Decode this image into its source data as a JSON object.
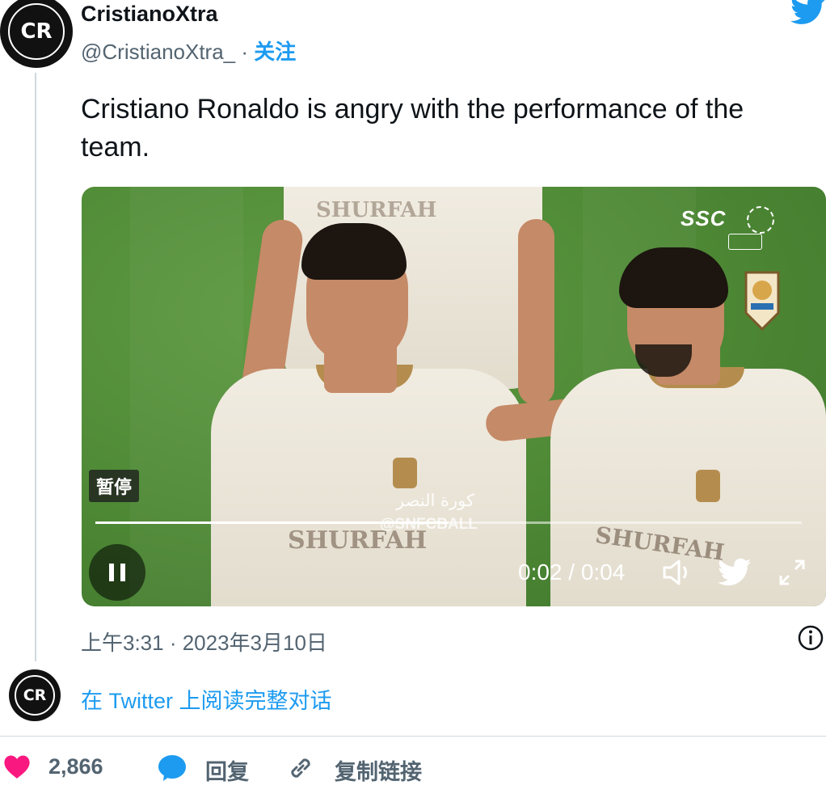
{
  "author": {
    "display_name": "CristianoXtra",
    "handle": "@CristianoXtra_",
    "separator": "·",
    "follow_label": "关注",
    "avatar_text": "CR"
  },
  "tweet": {
    "text": "Cristiano Ronaldo is angry with the performance of the team.",
    "timestamp": "上午3:31 · 2023年3月10日"
  },
  "video": {
    "overlay_label": "暂停",
    "time_display": "0:02 / 0:04",
    "progress_fraction": 0.5,
    "broadcaster": "SSC",
    "watermark_arabic": "كورة النصر",
    "watermark_handle": "@SNFCBALL",
    "jersey_sponsor": "SHURFAH"
  },
  "footer": {
    "read_conversation": "在 Twitter 上阅读完整对话",
    "likes_count": "2,866",
    "reply_label": "回复",
    "copy_link_label": "复制链接"
  },
  "colors": {
    "accent": "#1d9bf0",
    "like": "#f91880",
    "secondary_text": "#536471"
  },
  "icons": [
    "twitter-bird-icon",
    "info-icon",
    "heart-icon",
    "reply-bubble-icon",
    "link-icon",
    "pause-icon",
    "volume-icon",
    "fullscreen-icon"
  ]
}
